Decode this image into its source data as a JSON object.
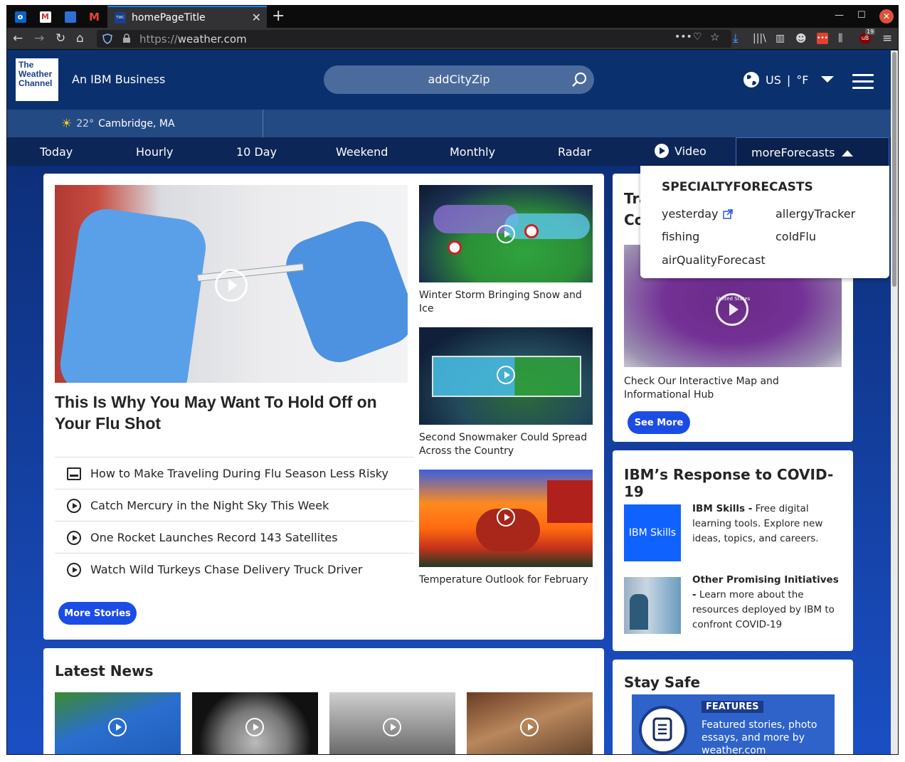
{
  "browser": {
    "tab_title": "homePageTitle",
    "url_scheme": "https://",
    "url_host": "weather.com",
    "badge_count": "19"
  },
  "header": {
    "logo_lines": [
      "The",
      "Weather",
      "Channel"
    ],
    "tagline": "An IBM Business",
    "search_placeholder": "addCityZip",
    "country": "US",
    "unit": "°F"
  },
  "location_bar": {
    "temp": "22°",
    "city": "Cambridge, MA"
  },
  "nav": {
    "items": [
      "Today",
      "Hourly",
      "10 Day",
      "Weekend",
      "Monthly",
      "Radar",
      "Video"
    ],
    "more": "moreForecasts"
  },
  "dropdown": {
    "title": "SPECIALTYFORECASTS",
    "col1": [
      "yesterday",
      "fishing",
      "airQualityForecast"
    ],
    "col2": [
      "allergyTracker",
      "coldFlu"
    ]
  },
  "main": {
    "hero_title": "This Is Why You May Want To Hold Off on Your Flu Shot",
    "stories": [
      "How to Make Traveling During Flu Season Less Risky",
      "Catch Mercury in the Night Sky This Week",
      "One Rocket Launches Record 143 Satellites",
      "Watch Wild Turkeys Chase Delivery Truck Driver"
    ],
    "more_stories": "More Stories",
    "videos": [
      "Winter Storm Bringing Snow and Ice",
      "Second Snowmaker Could Spread Across the Country",
      "Temperature Outlook for February"
    ]
  },
  "sidebar": {
    "card1_title": "Tra\nCo",
    "card1_text": "Check Our Interactive Map and Informational Hub",
    "map_label": "United States",
    "see_more": "See More",
    "ibm_title": "IBM’s Response to COVID-19",
    "ibm_skills_tile": "IBM Skills",
    "ibm_skills_head": "IBM Skills -",
    "ibm_skills_text": "Free digital learning tools. Explore new ideas, topics, and careers.",
    "other_head": "Other Promising Initiatives -",
    "other_text": "Learn more about the resources deployed by IBM to confront COVID-19",
    "stay_safe": "Stay Safe",
    "features_tag": "FEATURES",
    "features_text": "Featured stories, photo essays, and more by weather.com"
  },
  "latest": {
    "title": "Latest News"
  }
}
